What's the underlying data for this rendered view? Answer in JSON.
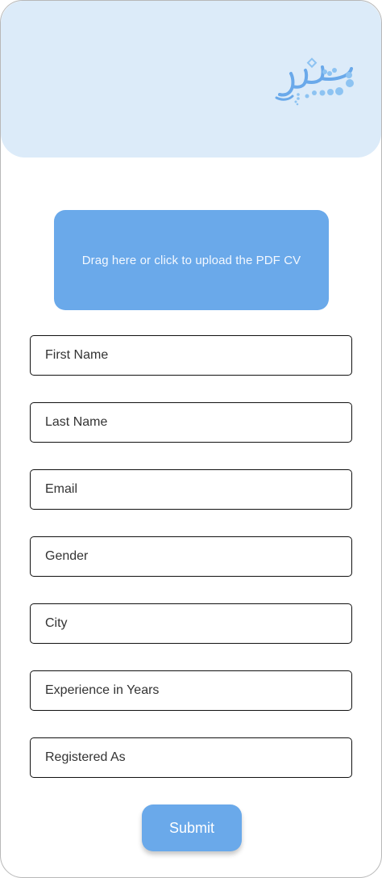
{
  "header": {
    "logo_icon": "arabic-calligraphy-logo",
    "background_color": "#dcebf9"
  },
  "upload": {
    "label": "Drag here or click to upload the PDF CV",
    "color": "#6aa9ea"
  },
  "form": {
    "first_name_placeholder": "First Name",
    "last_name_placeholder": "Last Name",
    "email_placeholder": "Email",
    "gender_placeholder": "Gender",
    "city_placeholder": "City",
    "experience_placeholder": "Experience in Years",
    "registered_as_placeholder": "Registered As"
  },
  "submit": {
    "label": "Submit",
    "color": "#6aa9ea"
  }
}
